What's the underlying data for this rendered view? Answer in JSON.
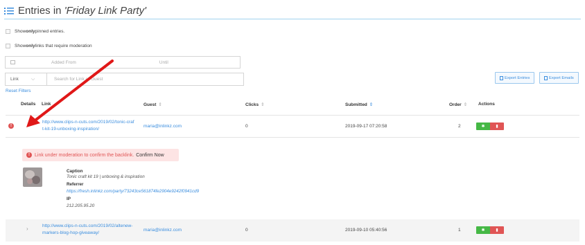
{
  "header": {
    "title_prefix": "Entries in ",
    "party_name": "'Friday Link Party'"
  },
  "filters": {
    "pinned_pre": "Show ",
    "pinned_bold": "only",
    "pinned_post": " pinned entries.",
    "moderation_pre": "Show ",
    "moderation_bold": "only",
    "moderation_post": " links that require moderation",
    "added_from_placeholder": "Added From",
    "until_placeholder": "Until",
    "search_field_value": "Link",
    "search_placeholder": "Search for Link or Guest",
    "reset_label": "Reset Filters"
  },
  "toolbar": {
    "export_entries": "Export Entries",
    "export_emails": "Export Emails"
  },
  "table": {
    "columns": {
      "details": "Details",
      "link": "Link",
      "guest": "Guest",
      "clicks": "Clicks",
      "submitted": "Submitted",
      "order": "Order",
      "actions": "Actions"
    },
    "sort_glyph": "⇕",
    "rows": [
      {
        "link_line1": "http://www.clips-n-cuts.com/2019/02/tonic-craf",
        "link_line2": "t-kit-19-unboxing-inspiration/",
        "guest": "maria@inlinkz.com",
        "clicks": "0",
        "submitted": "2019-09-17 07:20:58",
        "order": "2",
        "expanded": true,
        "warning": "!"
      },
      {
        "link_line1": "http://www.clips-n-cuts.com/2019/02/altenew-",
        "link_line2": "markers-blog-hop-giveaway/",
        "guest": "maria@inlinkz.com",
        "clicks": "0",
        "submitted": "2019-09-10 05:40:56",
        "order": "1",
        "expanded": false
      }
    ]
  },
  "detail": {
    "moderation_text": "Link under moderation to confirm the backlink.",
    "confirm_label": "Confirm Now",
    "caption_label": "Caption",
    "caption_value": "Tonic craft kit 19 | unboxing & inspiration",
    "referrer_label": "Referrer",
    "referrer_value": "https://fresh.inlinkz.com/party/73243ce561874fe2904e9242f0941cd9",
    "ip_label": "IP",
    "ip_value": "212.205.95.20"
  },
  "icons": {
    "expand_open": "⌄",
    "expand_closed": "›",
    "pin": "✱",
    "delete": "▮",
    "dropdown": "⌵"
  },
  "colors": {
    "accent": "#3a8dde",
    "danger": "#e05555",
    "success": "#45b845",
    "annotation_arrow": "#e01818"
  }
}
